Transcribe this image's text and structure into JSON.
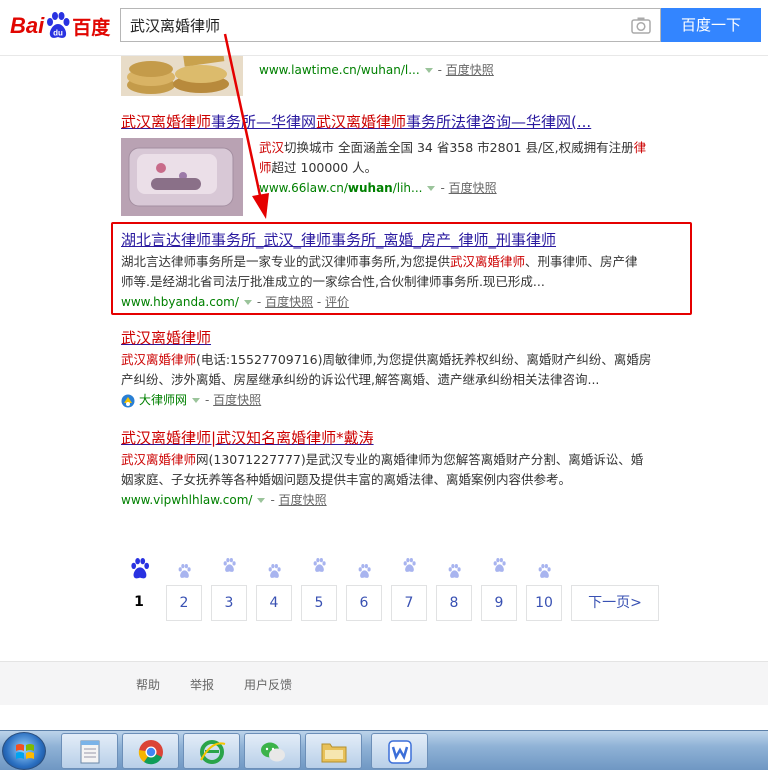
{
  "header": {
    "logo_bai": "Bai",
    "logo_du": "du",
    "logo_cn": "百度",
    "search_value": "武汉离婚律师",
    "search_button": "百度一下"
  },
  "results": [
    {
      "url": "www.lawtime.cn/wuhan/l...",
      "snapshot": "百度快照"
    },
    {
      "title_parts": [
        "武汉离婚律师",
        "事务所—华律网",
        "武汉离婚律师",
        "事务所法律咨询—华律网(..."
      ],
      "desc_line1": [
        "武汉",
        "切换城市 全面涵盖全国 34 省358 市2801 县/区,权威拥有注册",
        "律"
      ],
      "desc_line2": [
        "师",
        "超过 100000 人。"
      ],
      "url_prefix": "www.66law.cn/",
      "url_bold": "wuhan",
      "url_suffix": "/lih...",
      "snapshot": "百度快照"
    },
    {
      "title": "湖北言达律师事务所_武汉_律师事务所_离婚_房产_律师_刑事律师",
      "desc_line1": [
        "湖北言达律师事务所是一家专业的武汉律师事务所,为您提供",
        "武汉离婚律师",
        "、刑事律师、房产律"
      ],
      "desc_line2": "师等.是经湖北省司法厅批准成立的一家综合性,合伙制律师事务所.现已形成...",
      "url": "www.hbyanda.com/",
      "snapshot": "百度快照",
      "review": "评价"
    },
    {
      "title": "武汉离婚律师",
      "desc_line1": [
        "武汉离婚律师",
        "(电话:15527709716)周敏律师,为您提供离婚抚养权纠纷、离婚财产纠纷、离婚房"
      ],
      "desc_line2": "产纠纷、涉外离婚、房屋继承纠纷的诉讼代理,解答离婚、遗产继承纠纷相关法律咨询...",
      "source": "大律师网",
      "snapshot": "百度快照"
    },
    {
      "title_parts": [
        "武汉离婚律师",
        "|武汉知名离婚律师*戴涛"
      ],
      "desc_line1": [
        "武汉离婚律师",
        "网(13071227777)是武汉专业的离婚律师为您解答离婚财产分割、离婚诉讼、婚"
      ],
      "desc_line2": "姻家庭、子女抚养等各种婚姻问题及提供丰富的离婚法律、离婚案例内容供参考。",
      "url": "www.vipwhlhlaw.com/",
      "snapshot": "百度快照"
    }
  ],
  "pagination": {
    "pages": [
      "1",
      "2",
      "3",
      "4",
      "5",
      "6",
      "7",
      "8",
      "9",
      "10"
    ],
    "current": "1",
    "next": "下一页>"
  },
  "footer": {
    "help": "帮助",
    "report": "举报",
    "feedback": "用户反馈"
  },
  "colors": {
    "baidu_red": "#e10601",
    "baidu_blue": "#2932e1",
    "button_blue": "#3385ff",
    "link_title": "#2a1a9f",
    "highlight_red": "#c00",
    "url_green": "#008000",
    "annotation_red": "#e50000"
  },
  "taskbar_icons": [
    "start-orb-icon",
    "notepad-icon",
    "chrome-icon",
    "ie-icon",
    "wechat-icon",
    "folder-icon",
    "wps-icon"
  ]
}
